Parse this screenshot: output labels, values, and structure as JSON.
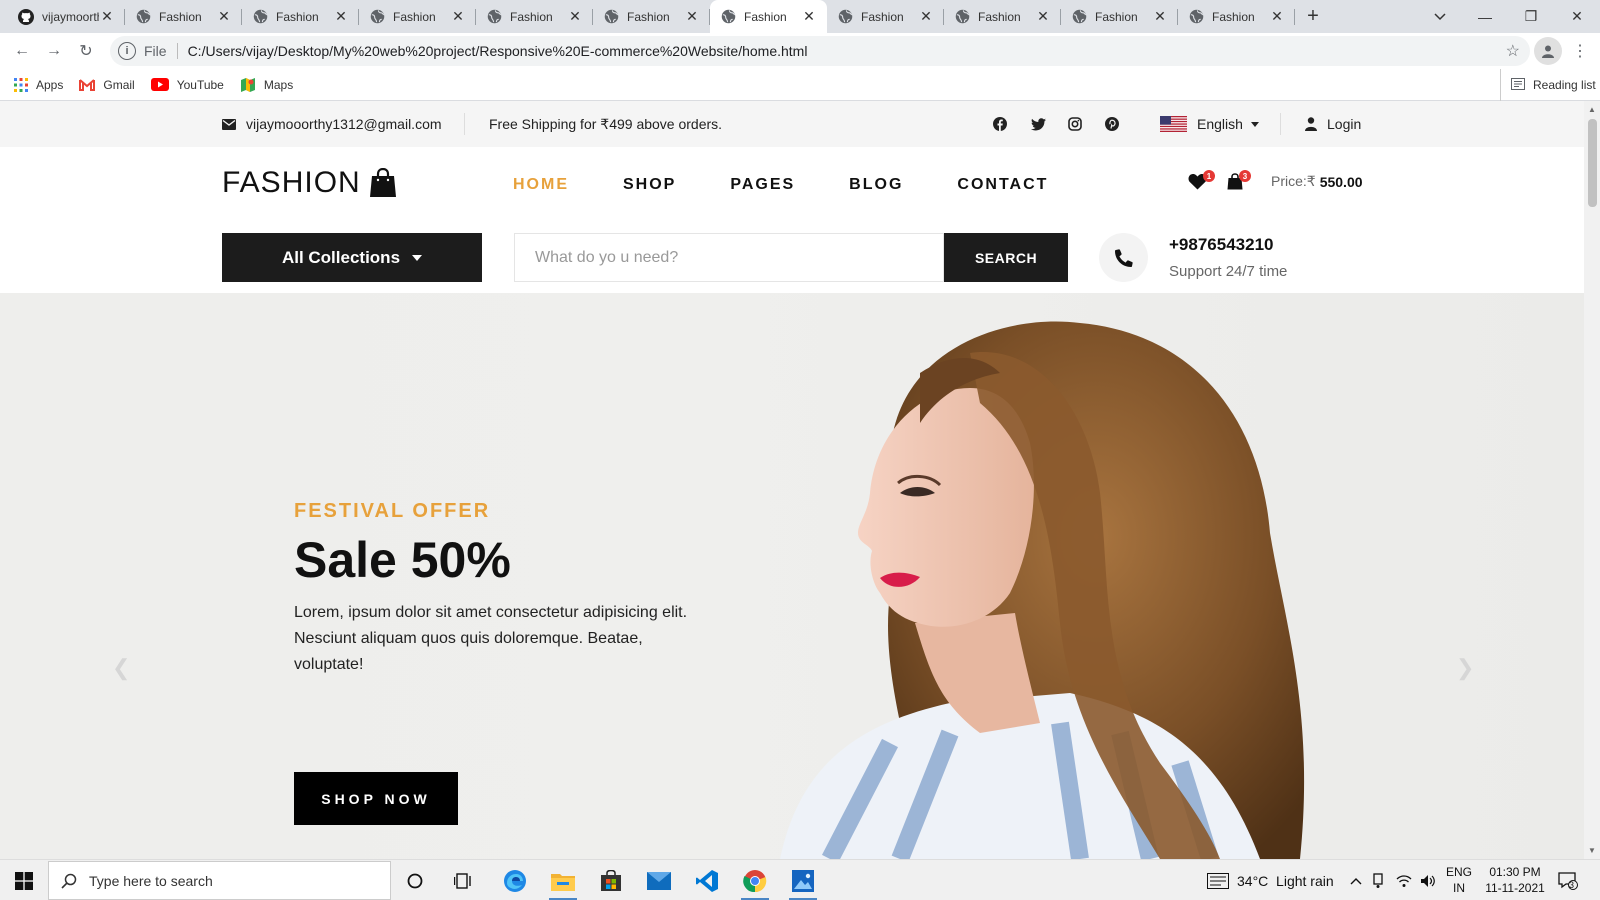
{
  "browser": {
    "tabs": [
      {
        "title": "vijaymoorthy",
        "icon": "github-icon",
        "active": false
      },
      {
        "title": "Fashion",
        "icon": "globe-icon",
        "active": false
      },
      {
        "title": "Fashion",
        "icon": "globe-icon",
        "active": false
      },
      {
        "title": "Fashion",
        "icon": "globe-icon",
        "active": false
      },
      {
        "title": "Fashion",
        "icon": "globe-icon",
        "active": false
      },
      {
        "title": "Fashion",
        "icon": "globe-icon",
        "active": false
      },
      {
        "title": "Fashion",
        "icon": "globe-icon",
        "active": true
      },
      {
        "title": "Fashion",
        "icon": "globe-icon",
        "active": false
      },
      {
        "title": "Fashion",
        "icon": "globe-icon",
        "active": false
      },
      {
        "title": "Fashion",
        "icon": "globe-icon",
        "active": false
      },
      {
        "title": "Fashion",
        "icon": "globe-icon",
        "active": false
      }
    ],
    "address": {
      "scheme_label": "File",
      "url": "C:/Users/vijay/Desktop/My%20web%20project/Responsive%20E-commerce%20Website/home.html"
    },
    "bookmarks": [
      {
        "label": "Apps",
        "icon": "apps-grid-icon"
      },
      {
        "label": "Gmail",
        "icon": "gmail-icon"
      },
      {
        "label": "YouTube",
        "icon": "youtube-icon"
      },
      {
        "label": "Maps",
        "icon": "maps-icon"
      }
    ],
    "reading_list": "Reading list"
  },
  "topbar": {
    "email": "vijaymooorthy1312@gmail.com",
    "shipping": "Free Shipping for ₹499 above orders.",
    "social": [
      "facebook-icon",
      "twitter-icon",
      "instagram-icon",
      "pinterest-icon"
    ],
    "language": "English",
    "login": "Login"
  },
  "header": {
    "logo": "FASHION",
    "nav": [
      {
        "label": "HOME",
        "active": true
      },
      {
        "label": "SHOP",
        "active": false
      },
      {
        "label": "PAGES",
        "active": false
      },
      {
        "label": "BLOG",
        "active": false
      },
      {
        "label": "CONTACT",
        "active": false
      }
    ],
    "wishlist_count": "1",
    "cart_count": "3",
    "price_label": "Price:₹",
    "price_value": "550.00",
    "collections_label": "All Collections",
    "search_placeholder": "What do yo u need?",
    "search_button": "SEARCH",
    "phone": "+9876543210",
    "support": "Support 24/7 time"
  },
  "hero": {
    "eyebrow": "FESTIVAL OFFER",
    "title": "Sale 50%",
    "description": "Lorem, ipsum dolor sit amet consectetur adipisicing elit. Nesciunt aliquam quos quis doloremque. Beatae, voluptate!",
    "cta": "SHOP NOW"
  },
  "taskbar": {
    "search_placeholder": "Type here to search",
    "weather": "34°C  Light rain",
    "lang_top": "ENG",
    "lang_bottom": "IN",
    "time": "01:30 PM",
    "date": "11-11-2021",
    "notifications": "3"
  },
  "colors": {
    "accent": "#e7a13b",
    "dark": "#1c1c1c",
    "badge": "#e53935"
  }
}
